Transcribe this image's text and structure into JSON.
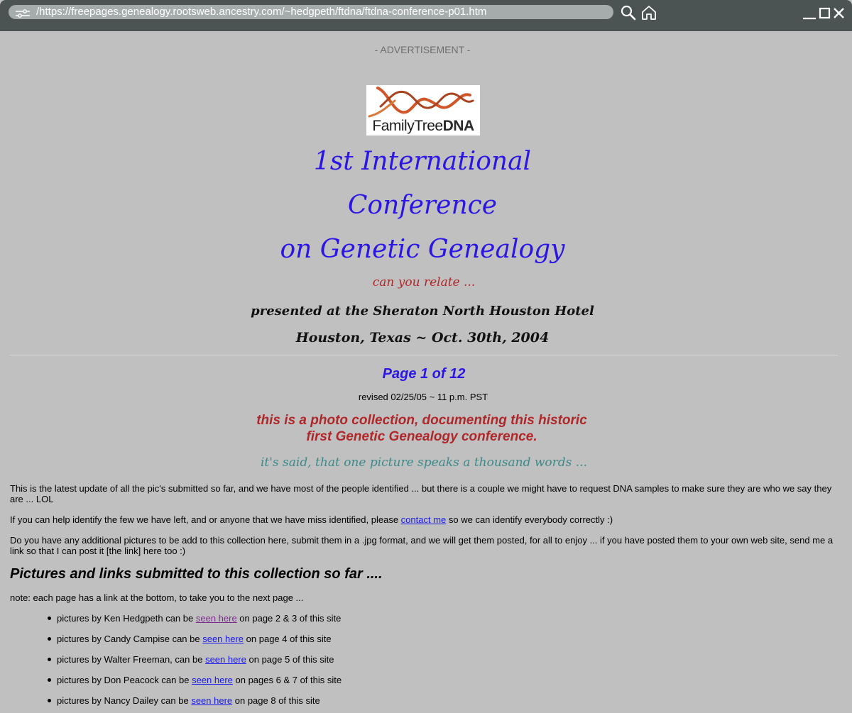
{
  "browser": {
    "url": "/https://freepages.genealogy.rootsweb.ancestry.com/~hedgpeth/ftdna/ftdna-conference-p01.htm",
    "icons": [
      "tune-icon",
      "search-icon",
      "home-icon",
      "minimize-icon",
      "maximize-icon",
      "close-icon"
    ]
  },
  "page": {
    "advertisement": "- ADVERTISEMENT -",
    "logo": {
      "text_light": "FamilyTree",
      "text_bold": "DNA"
    },
    "title_lines": [
      "1st International",
      "Conference",
      "on Genetic Genealogy"
    ],
    "tagline": "can you relate ...",
    "presented": "presented at the Sheraton North Houston Hotel",
    "location_date": "Houston, Texas  ~ Oct. 30th, 2004",
    "page_number": "Page 1 of  12",
    "revised": "revised 02/25/05 ~ 11 p.m. PST",
    "red_lines": [
      "this is a photo collection, documenting this historic",
      "first Genetic Genealogy conference."
    ],
    "thousand_words": "it's said, that one picture speaks a thousand words ...",
    "para1": "This is the latest update of all the pic's submitted so far, and we have most of the people identified ... but there is a couple we might have to request DNA samples to make sure they are who we say they are ... LOL",
    "para2": {
      "before": "If you can help identify the few we have left, and or anyone that we have miss identified, please ",
      "link": "contact me",
      "after": " so we can identify everybody correctly :)"
    },
    "para3": "Do you have any additional pictures to be add to this collection here, submit them  in a .jpg format, and we will get them posted, for all to enjoy ... if you have posted them to your own web site, send me a link so that I can post it [the link] here too :)",
    "heading": "Pictures and links submitted to this collection so far ....",
    "note": "note: each page has a link at the bottom, to take you to the next page ...",
    "list": [
      {
        "before": "pictures by Ken Hedgpeth can be ",
        "link": "seen here",
        "after": " on page 2 & 3 of this site"
      },
      {
        "before": "pictures by Candy Campise can be ",
        "link": "seen here",
        "after": " on page 4 of this site"
      },
      {
        "before": "pictures by Walter Freeman, can be ",
        "link": "seen here",
        "after": " on page 5 of this site"
      },
      {
        "before": "pictures by Don Peacock can be ",
        "link": "seen here",
        "after": " on pages 6 & 7 of this site"
      },
      {
        "before": "pictures by Nancy Dailey can be ",
        "link": "seen here",
        "after": " on page 8 of this site"
      }
    ]
  },
  "colors": {
    "page_bg": "#c0c0c0",
    "chrome_bg": "#4b5353",
    "title_blue": "#2b16e6",
    "accent_red": "#b0272a",
    "teal": "#3d8a8a",
    "link": "#1a1aee",
    "visited_link": "#7c2d8e"
  }
}
